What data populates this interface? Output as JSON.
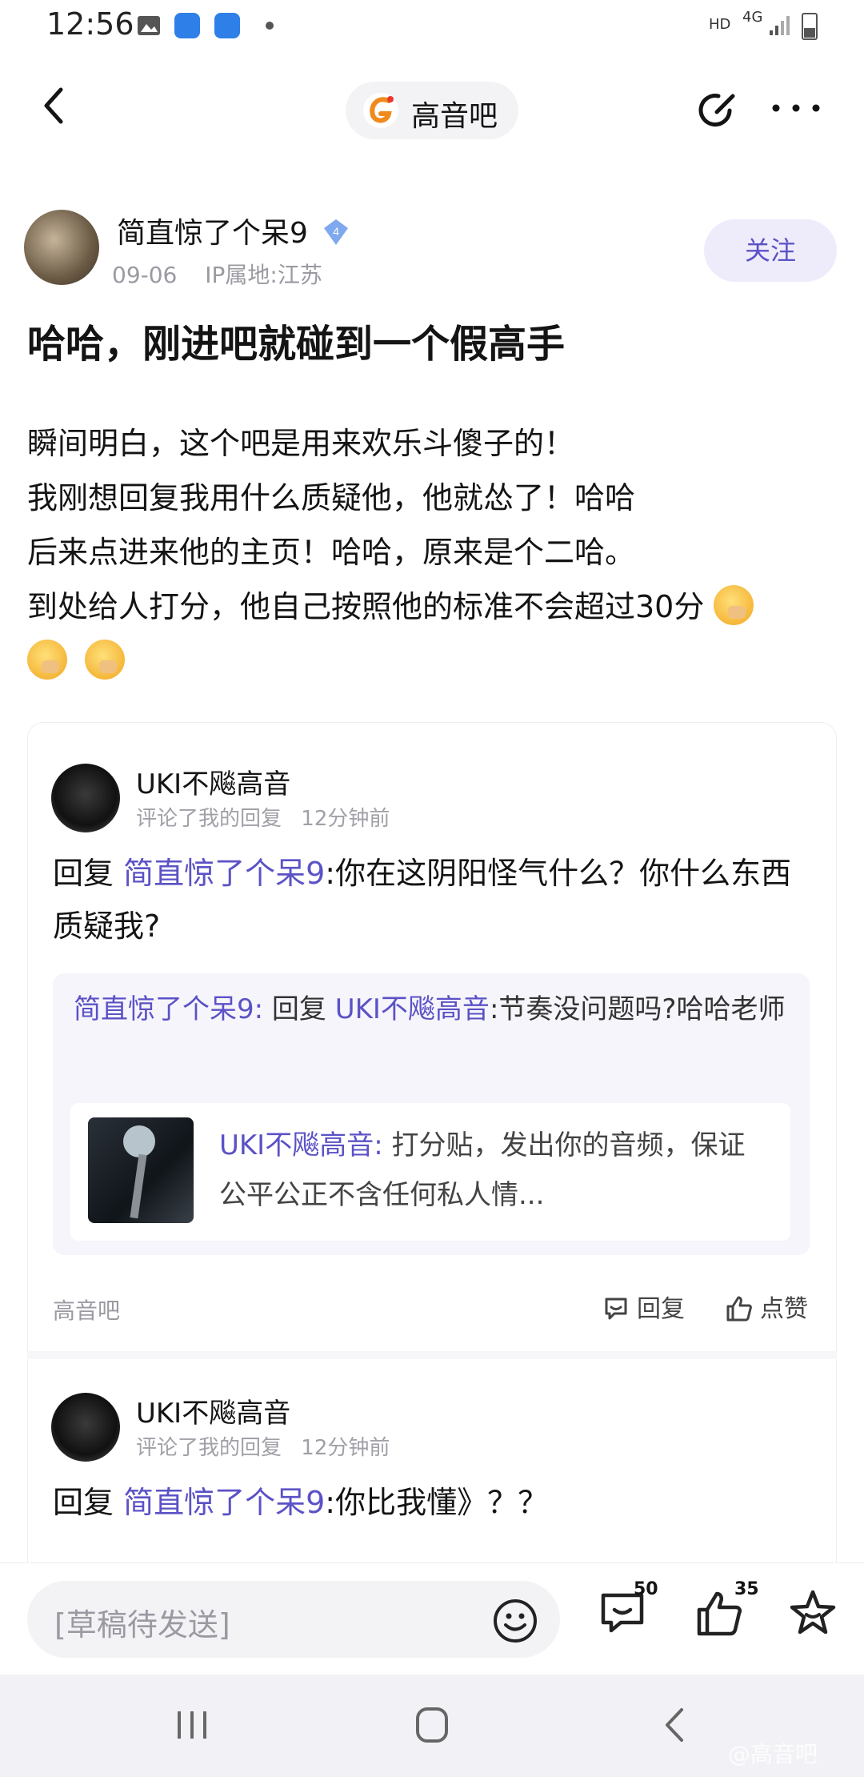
{
  "status_bar": {
    "time": "12:56",
    "hd_label": "HD",
    "network_label": "4G"
  },
  "header": {
    "forum_name": "高音吧",
    "icons": [
      "back-icon",
      "edit-icon",
      "more-icon"
    ]
  },
  "post": {
    "author": "简直惊了个呆9",
    "level": "4",
    "date": "09-06",
    "ip_location": "IP属地:江苏",
    "follow_label": "关注",
    "title": "哈哈，刚进吧就碰到一个假高手",
    "body_lines": [
      "瞬间明白，这个吧是用来欢乐斗傻子的！",
      "我刚想回复我用什么质疑他，他就怂了！哈哈",
      "后来点进来他的主页！哈哈，原来是个二哈。",
      "到处给人打分，他自己按照他的标准不会超过30分"
    ]
  },
  "comments": [
    {
      "user": "UKI不飚高音",
      "action": "评论了我的回复",
      "time": "12分钟前",
      "reply_prefix": "回复",
      "reply_target": "简直惊了个呆9",
      "text": ":你在这阴阳怪气什么？你什么东西质疑我?",
      "quote": {
        "author": "简直惊了个呆9:",
        "reply_prefix": "回复",
        "reply_target": "UKI不飚高音",
        "text": ":节奏没问题吗?哈哈老师",
        "ref_author": "UKI不飚高音:",
        "ref_text": "打分贴，发出你的音频，保证公平公正不含任何私人情..."
      },
      "forum_tag": "高音吧",
      "reply_label": "回复",
      "like_label": "点赞"
    },
    {
      "user": "UKI不飚高音",
      "action": "评论了我的回复",
      "time": "12分钟前",
      "reply_prefix": "回复",
      "reply_target": "简直惊了个呆9",
      "text": ":你比我懂》？？"
    }
  ],
  "bottom_bar": {
    "draft_placeholder": "[草稿待发送]",
    "comment_count": "50",
    "like_count": "35"
  },
  "watermark": "@高音吧",
  "colors": {
    "accent": "#5b52c6",
    "meta_gray": "#9a9aa2",
    "pill_bg": "#f3f3f6"
  }
}
